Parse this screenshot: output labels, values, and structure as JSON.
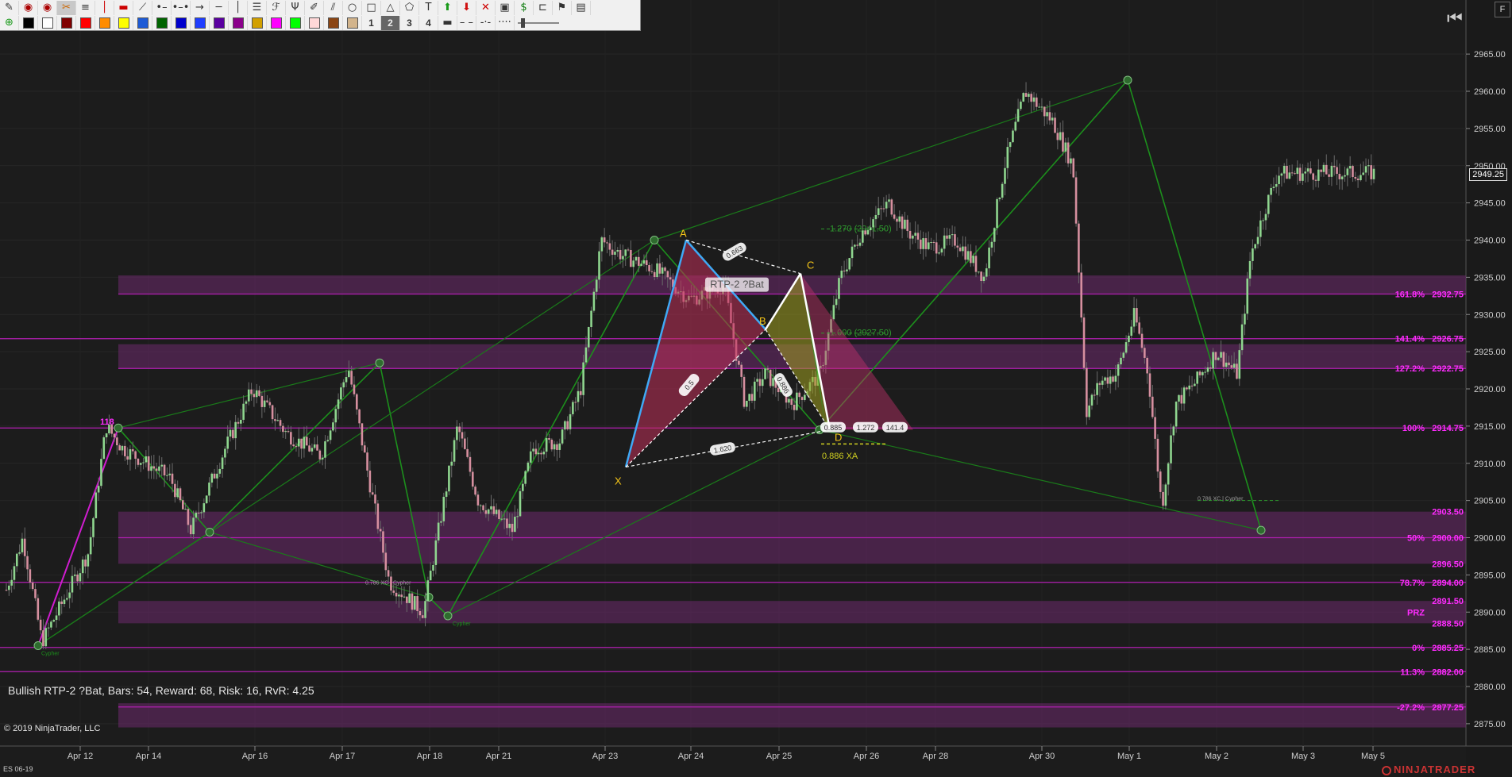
{
  "toolbar": {
    "row1_icons": [
      "pencil-icon",
      "eye-icon",
      "eye-icon",
      "scissors-icon",
      "hline-color-icon",
      "vline-icon",
      "hline-red-icon",
      "line-icon",
      "ray-icon",
      "extended-line-icon",
      "arrow-line-icon",
      "horizontal-line-icon",
      "vertical-line-icon",
      "fibonacci-icon",
      "fib-ext-icon",
      "pitchfork-icon",
      "pen-icon",
      "channel-icon",
      "circle-icon",
      "rectangle-icon",
      "triangle-icon",
      "polygon-icon",
      "text-icon",
      "arrow-up-icon",
      "arrow-down-icon",
      "remove-icon",
      "template-icon",
      "dollar-icon",
      "ruler-icon",
      "flag-icon",
      "settings-icon"
    ],
    "row2_swatches": [
      "#000000",
      "#ffffff",
      "#800000",
      "#ff0000",
      "#ff8c00",
      "#ffff00",
      "#1e5bd6",
      "#006400",
      "#0000cd",
      "#1f3dff",
      "#5a00a0",
      "#8b008b",
      "#d2a000",
      "#ff00ff",
      "#00ff00",
      "#ffd8d8",
      "#8b4513",
      "#d2b48c"
    ],
    "row2_widths": [
      "1",
      "2",
      "3",
      "4"
    ],
    "selected_width": "2"
  },
  "chart": {
    "instrument": "ES 06-19",
    "copyright": "© 2019 NinjaTrader, LLC",
    "status": "Bullish RTP-2 ?Bat, Bars: 54, Reward: 68, Risk: 16, RvR: 4.25",
    "logo": "NINJATRADER",
    "current_price": "2949.25",
    "f_button": "F",
    "pattern_label": "RTP-2 ?Bat",
    "pattern_points": {
      "X": "X",
      "A": "A",
      "B": "B",
      "C": "C",
      "D": "D"
    },
    "ratio_labels": [
      "0.663",
      "0.5",
      "1.620",
      "0.886",
      "0.885",
      "1.272",
      "141.4"
    ],
    "annotations": [
      "1.270 (2941.50)",
      "1.000 (2927.50)",
      "0.886 XA",
      "0.886 XC",
      "0.786 XC | Cypher",
      "0.786 XC | Cypher",
      "Cypher",
      "Cypher",
      "118"
    ]
  },
  "chart_data": {
    "type": "candlestick",
    "y_axis": {
      "min": 2872,
      "max": 2968,
      "ticks": [
        2875,
        2880,
        2885,
        2890,
        2895,
        2900,
        2905,
        2910,
        2915,
        2920,
        2925,
        2930,
        2935,
        2940,
        2945,
        2950,
        2955,
        2960,
        2965
      ]
    },
    "x_labels": [
      "Apr 12",
      "Apr 14",
      "Apr 16",
      "Apr 17",
      "Apr 18",
      "Apr 21",
      "Apr 23",
      "Apr 24",
      "Apr 25",
      "Apr 26",
      "Apr 28",
      "Apr 30",
      "May 1",
      "May 2",
      "May 3",
      "May 5"
    ],
    "levels": [
      {
        "pct": "161.8%",
        "price": "2932.75",
        "value": 2932.75
      },
      {
        "pct": "141.4%",
        "price": "2926.75",
        "value": 2926.75
      },
      {
        "pct": "127.2%",
        "price": "2922.75",
        "value": 2922.75
      },
      {
        "pct": "100%",
        "price": "2914.75",
        "value": 2914.75
      },
      {
        "pct": "",
        "price": "2903.50",
        "value": 2903.5
      },
      {
        "pct": "50%",
        "price": "2900.00",
        "value": 2900.0
      },
      {
        "pct": "",
        "price": "2896.50",
        "value": 2896.5
      },
      {
        "pct": "78.7%",
        "price": "2894.00",
        "value": 2894.0
      },
      {
        "pct": "",
        "price": "2891.50",
        "value": 2891.5
      },
      {
        "pct": "PRZ",
        "price": "",
        "value": 2890.0
      },
      {
        "pct": "",
        "price": "2888.50",
        "value": 2888.5
      },
      {
        "pct": "0%",
        "price": "2885.25",
        "value": 2885.25
      },
      {
        "pct": "11.3%",
        "price": "2882.00",
        "value": 2882.0
      },
      {
        "pct": "-27.2%",
        "price": "2877.25",
        "value": 2877.25
      }
    ],
    "zones": [
      [
        2932.75,
        2935.25
      ],
      [
        2922.75,
        2926.0
      ],
      [
        2896.5,
        2903.5
      ],
      [
        2888.5,
        2891.5
      ],
      [
        2874.5,
        2877.75
      ]
    ],
    "zigzag": [
      {
        "x": "Apr 11",
        "y": 2885.5
      },
      {
        "x": "Apr 12",
        "y": 2914.75
      },
      {
        "x": "Apr 15",
        "y": 2900.75
      },
      {
        "x": "Apr 17",
        "y": 2923.5
      },
      {
        "x": "Apr 18",
        "y": 2892.0
      },
      {
        "x": "Apr 18",
        "y": 2889.5
      },
      {
        "x": "Apr 23",
        "y": 2940.0
      },
      {
        "x": "Apr 25",
        "y": 2914.5
      },
      {
        "x": "May 1",
        "y": 2961.5
      },
      {
        "x": "May 2",
        "y": 2901.0
      }
    ],
    "pattern": {
      "X": 2909.5,
      "A": 2940.0,
      "B": 2928.0,
      "C": 2935.5,
      "D": 2914.5
    },
    "series": [
      {
        "name": "ES 06-19",
        "segments": [
          [
            0.0,
            2893
          ],
          [
            0.012,
            2900
          ],
          [
            0.026,
            2886
          ],
          [
            0.06,
            2898
          ],
          [
            0.073,
            2915
          ],
          [
            0.085,
            2912
          ],
          [
            0.12,
            2908
          ],
          [
            0.135,
            2901
          ],
          [
            0.16,
            2912
          ],
          [
            0.18,
            2920
          ],
          [
            0.205,
            2914
          ],
          [
            0.23,
            2911
          ],
          [
            0.25,
            2923
          ],
          [
            0.265,
            2908
          ],
          [
            0.28,
            2894
          ],
          [
            0.293,
            2892
          ],
          [
            0.305,
            2890
          ],
          [
            0.33,
            2915
          ],
          [
            0.345,
            2905
          ],
          [
            0.37,
            2901
          ],
          [
            0.385,
            2912
          ],
          [
            0.405,
            2913
          ],
          [
            0.42,
            2920
          ],
          [
            0.435,
            2940
          ],
          [
            0.45,
            2938
          ],
          [
            0.475,
            2936
          ],
          [
            0.5,
            2932
          ],
          [
            0.525,
            2934
          ],
          [
            0.54,
            2918
          ],
          [
            0.555,
            2922
          ],
          [
            0.575,
            2918
          ],
          [
            0.595,
            2922
          ],
          [
            0.61,
            2935
          ],
          [
            0.625,
            2941
          ],
          [
            0.645,
            2945
          ],
          [
            0.66,
            2941
          ],
          [
            0.675,
            2939
          ],
          [
            0.695,
            2940
          ],
          [
            0.715,
            2935
          ],
          [
            0.73,
            2950
          ],
          [
            0.745,
            2960
          ],
          [
            0.765,
            2956
          ],
          [
            0.78,
            2950
          ],
          [
            0.79,
            2917
          ],
          [
            0.8,
            2921
          ],
          [
            0.812,
            2922
          ],
          [
            0.825,
            2930
          ],
          [
            0.835,
            2922
          ],
          [
            0.845,
            2904
          ],
          [
            0.855,
            2918
          ],
          [
            0.87,
            2921
          ],
          [
            0.885,
            2925
          ],
          [
            0.9,
            2922
          ],
          [
            0.91,
            2938
          ],
          [
            0.92,
            2944
          ],
          [
            0.93,
            2949
          ]
        ]
      }
    ]
  }
}
